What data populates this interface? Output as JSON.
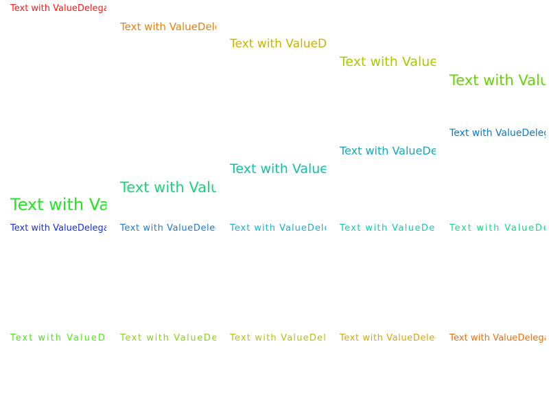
{
  "texts": [
    {
      "label": "Text with ValueDelegate",
      "color": "#ff1a1a"
    },
    {
      "label": "Text with ValueDelegate",
      "color": "#e5820c"
    },
    {
      "label": "Text with ValueDelegate",
      "color": "#c8b400"
    },
    {
      "label": "Text with ValueDelegate",
      "color": "#a6cc00"
    },
    {
      "label": "Text with ValueDelegate",
      "color": "#66d400"
    },
    {
      "label": "Text with ValueDelegate",
      "color": "#0a7acc"
    },
    {
      "label": "Text with ValueDelegate",
      "color": "#12a8b8"
    },
    {
      "label": "Text with ValueDelegate",
      "color": "#12c0a6"
    },
    {
      "label": "Text with ValueDelegate",
      "color": "#18d678"
    },
    {
      "label": "Text with ValueDelegate",
      "color": "#1fe81f"
    },
    {
      "label": "Text with ValueDelegate",
      "color": "#1a32d4"
    },
    {
      "label": "Text with ValueDelegate",
      "color": "#1e7ad6"
    },
    {
      "label": "Text with ValueDelegate",
      "color": "#1ab0d0"
    },
    {
      "label": "Text with ValueDelegate",
      "color": "#16c8b0"
    },
    {
      "label": "Text with ValueDelegate",
      "color": "#1ad68a"
    },
    {
      "label": "Text with ValueDelegate",
      "color": "#55e21e"
    },
    {
      "label": "Text with ValueDelegate",
      "color": "#88d018"
    },
    {
      "label": "Text with ValueDelegate",
      "color": "#b4c016"
    },
    {
      "label": "Text with ValueDelegate",
      "color": "#d4a612"
    },
    {
      "label": "Text with ValueDelegate",
      "color": "#e8700e"
    }
  ]
}
